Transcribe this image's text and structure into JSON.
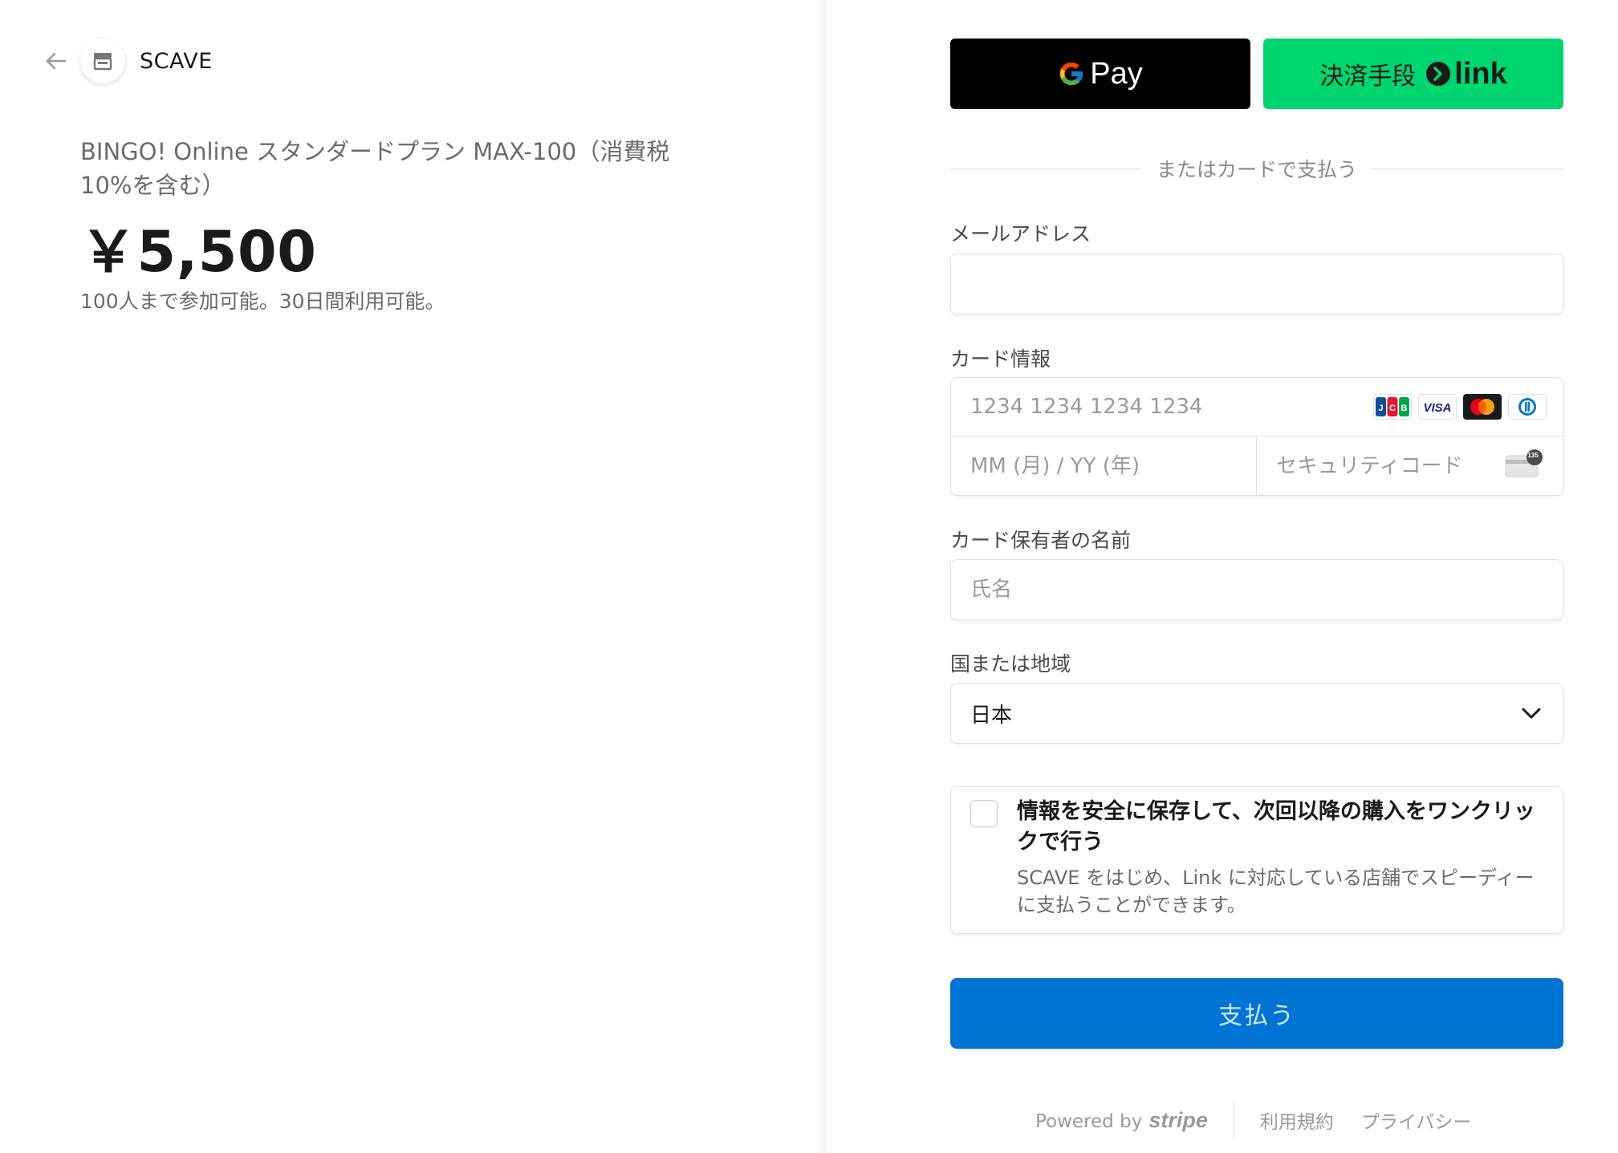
{
  "merchant": {
    "name": "SCAVE"
  },
  "product": {
    "name": "BINGO! Online スタンダードプラン MAX-100（消費税10%を含む）",
    "price": "￥5,500",
    "description": "100人まで参加可能。30日間利用可能。"
  },
  "wallets": {
    "gpay_label": "Pay",
    "link_label": "決済手段",
    "link_word": "link"
  },
  "divider_text": "またはカードで支払う",
  "email": {
    "label": "メールアドレス",
    "value": ""
  },
  "card": {
    "label": "カード情報",
    "number_placeholder": "1234 1234 1234 1234",
    "expiry_placeholder": "MM (月) / YY (年)",
    "cvc_placeholder": "セキュリティコード",
    "brands": [
      "JCB",
      "VISA",
      "Mastercard",
      "Diners"
    ],
    "cvc_hint": "135"
  },
  "cardholder": {
    "label": "カード保有者の名前",
    "placeholder": "氏名"
  },
  "country": {
    "label": "国または地域",
    "value": "日本"
  },
  "save_info": {
    "title": "情報を安全に保存して、次回以降の購入をワンクリックで行う",
    "description": "SCAVE をはじめ、Link に対応している店舗でスピーディーに支払うことができます。"
  },
  "pay_button": {
    "label": "支払う"
  },
  "footer": {
    "powered_by": "Powered by",
    "stripe": "stripe",
    "terms": "利用規約",
    "privacy": "プライバシー"
  },
  "colors": {
    "accent": "#0074d4",
    "link_green": "#00d66f",
    "gpay_black": "#000000"
  }
}
